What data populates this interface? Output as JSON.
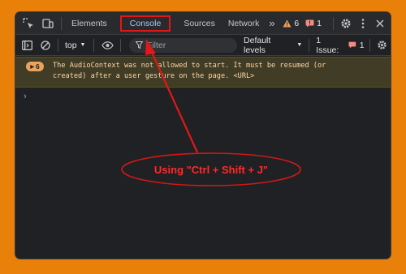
{
  "tabs": [
    {
      "label": "Elements"
    },
    {
      "label": "Console"
    },
    {
      "label": "Sources"
    },
    {
      "label": "Network"
    }
  ],
  "more_tabs_glyph": "»",
  "warning_count": "6",
  "error_count": "1",
  "toolbar": {
    "context": "top",
    "filter_placeholder": "Filter",
    "levels": "Default levels",
    "issues_label": "1 Issue:",
    "issues_count": "1"
  },
  "console": {
    "warn_count": "6",
    "warn_message": "The AudioContext was not allowed to start. It must be resumed (or\ncreated) after a user gesture on the page. <URL>",
    "prompt": "›"
  },
  "annotation": {
    "text": "Using \"Ctrl + Shift + J\"",
    "color": "#ff2a2a"
  },
  "colors": {
    "background": "#e8800a",
    "panel": "#202124",
    "accent": "#a8c7fa",
    "highlight": "#e01818"
  },
  "icons": [
    "inspect-icon",
    "device-toolbar-icon",
    "warning-icon",
    "error-icon",
    "settings-icon",
    "more-options-icon",
    "close-icon",
    "sidebar-icon",
    "clear-icon",
    "eye-icon",
    "filter-icon",
    "gear-icon"
  ]
}
